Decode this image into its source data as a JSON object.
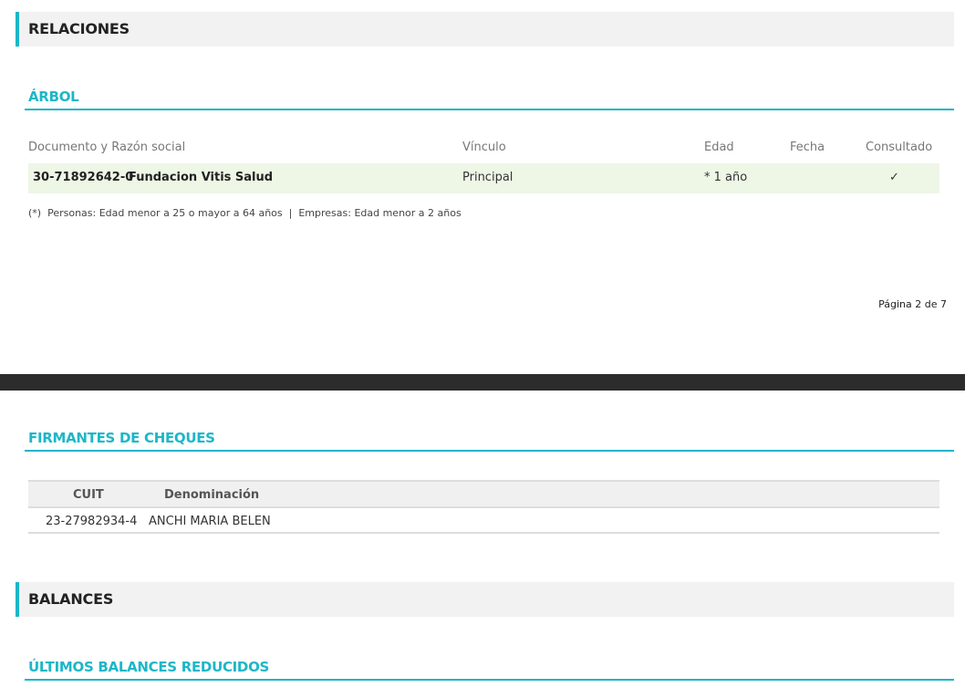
{
  "relaciones": {
    "section_title": "RELACIONES",
    "arbol": {
      "title": "ÁRBOL",
      "columns": [
        "Documento y Razón social",
        "Vínculo",
        "Edad",
        "Fecha",
        "Consultado"
      ],
      "rows": [
        {
          "documento": "30-71892642-0",
          "razon_social": "Fundacion Vitis Salud",
          "vinculo": "Principal",
          "edad": "* 1 año",
          "fecha": "",
          "consultado": "✓"
        }
      ],
      "footnote": "(*)  Personas: Edad menor a 25 o mayor a 64 años  |  Empresas: Edad menor a 2 años"
    }
  },
  "pagination": {
    "label": "Página 2 de 7"
  },
  "firmantes": {
    "title": "FIRMANTES DE CHEQUES",
    "columns": [
      "CUIT",
      "Denominación"
    ],
    "rows": [
      {
        "cuit": "23-27982934-4",
        "denominacion": "ANCHI MARIA BELEN"
      }
    ]
  },
  "balances": {
    "section_title": "BALANCES",
    "subsection_title": "ÚLTIMOS BALANCES REDUCIDOS"
  },
  "colors": {
    "accent": "#1db6c8",
    "row_highlight": "#eef6e6",
    "page_break": "#2c2c2c"
  }
}
